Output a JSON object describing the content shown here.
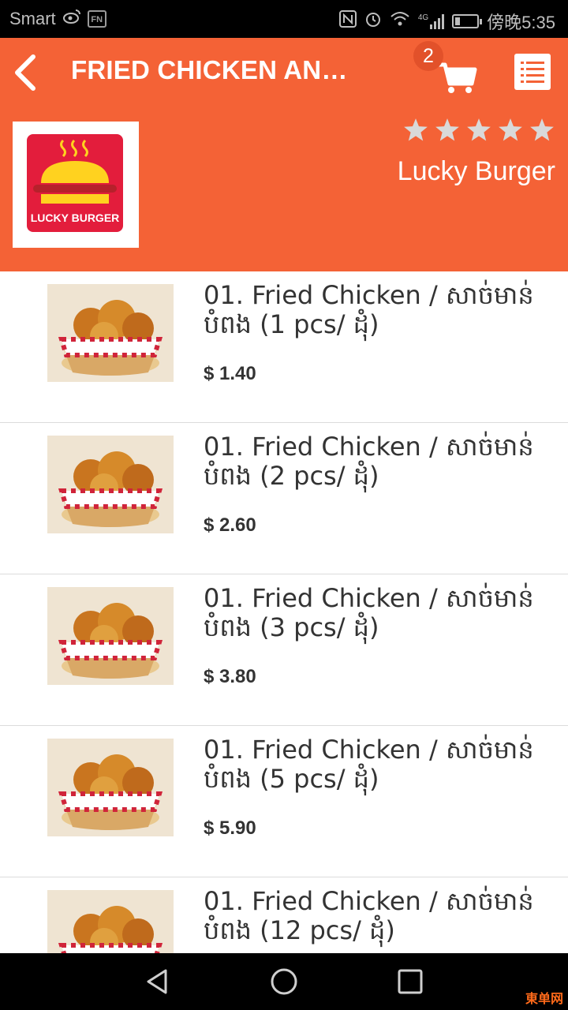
{
  "status_bar": {
    "carrier": "Smart",
    "badge": "FN",
    "network": "4G",
    "time": "傍晚5:35"
  },
  "header": {
    "title": "FRIED CHICKEN AND ...",
    "cart_count": "2",
    "store_name": "Lucky Burger",
    "logo_text": "LUCKY BURGER",
    "rating": 5,
    "max_rating": 5
  },
  "items": [
    {
      "name": "01. Fried Chicken / សាច់មាន់បំពង (1 pcs/ ដុំ)",
      "price": "$ 1.40"
    },
    {
      "name": "01. Fried Chicken / សាច់មាន់បំពង (2 pcs/ ដុំ)",
      "price": "$ 2.60"
    },
    {
      "name": "01. Fried Chicken / សាច់មាន់បំពង (3 pcs/ ដុំ)",
      "price": "$ 3.80"
    },
    {
      "name": "01. Fried Chicken / សាច់មាន់បំពង (5 pcs/ ដុំ)",
      "price": "$ 5.90"
    },
    {
      "name": "01. Fried Chicken / សាច់មាន់បំពង (12 pcs/ ដុំ)",
      "price": ""
    }
  ],
  "watermark": "東单网",
  "colors": {
    "header_bg": "#f46236",
    "logo_red": "#e31d3c",
    "bun_yellow": "#ffd21f",
    "patty": "#b6212b",
    "menu_icon": "#f46236"
  }
}
